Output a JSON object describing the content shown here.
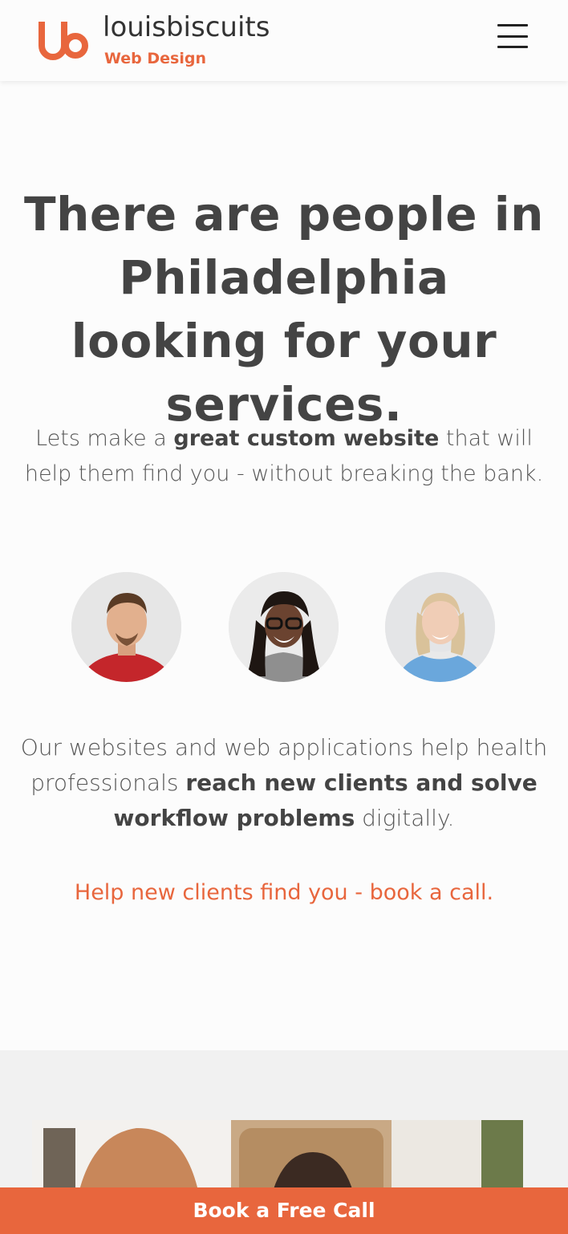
{
  "header": {
    "brand_name": "louisbiscuits",
    "brand_sub": "Web Design",
    "logo_icon": "lb-logo-icon",
    "menu_icon": "hamburger-menu-icon"
  },
  "hero": {
    "title": "There are people in Philadelphia looking for your services.",
    "sub_pre": "Lets make a ",
    "sub_bold": "great custom website",
    "sub_post": " that will help them find you - without breaking the bank."
  },
  "avatars": [
    {
      "name": "man in red polo"
    },
    {
      "name": "woman with glasses"
    },
    {
      "name": "woman with headphones"
    }
  ],
  "description": {
    "pre": "Our websites and web applications help health professionals ",
    "bold": "reach new clients and solve workflow problems",
    "post": " digitally."
  },
  "cta_link": "Help new clients find you - book a call.",
  "book_bar": "Book a Free Call",
  "colors": {
    "accent": "#e8663d",
    "text": "#444444",
    "background": "#fcfcfc",
    "section_gray": "#f1f1f1"
  }
}
